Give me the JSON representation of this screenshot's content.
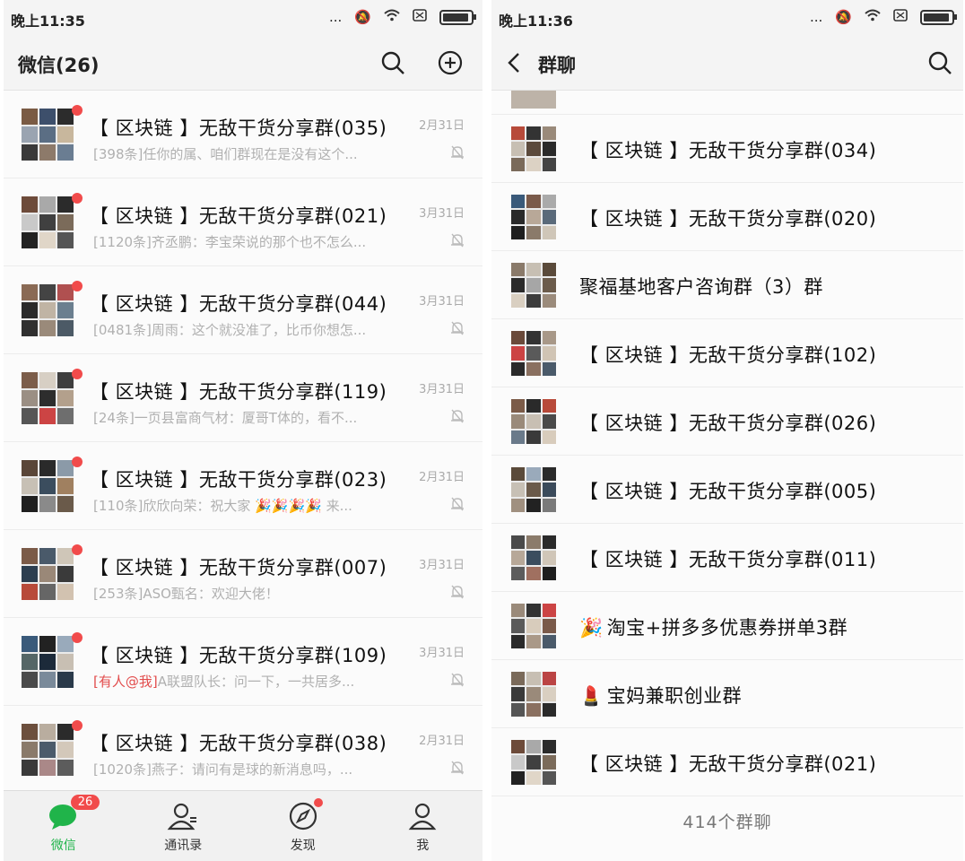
{
  "left": {
    "statusbar": {
      "time": "晚上11:35",
      "dots": "..."
    },
    "header": {
      "title": "微信(26)"
    },
    "chats": [
      {
        "name": "【 区块链 】无敌干货分享群(035)",
        "time": "2月31日",
        "preview": "[398条]任你的属、咱们群现在是没有这个...",
        "mention": "",
        "colors": [
          "#7a5b44",
          "#3d4f6b",
          "#2c2c2c",
          "#9aa4b1",
          "#5b6e84",
          "#c8b79d",
          "#3a3a3a",
          "#8d7a6a",
          "#6a7d92"
        ]
      },
      {
        "name": "【 区块链 】无敌干货分享群(021)",
        "time": "3月31日",
        "preview": "[1120条]齐丞鹏：李宝荣说的那个也不怎么...",
        "mention": "",
        "colors": [
          "#6d4b3a",
          "#a9a9a9",
          "#2b2b2b",
          "#c9c9c9",
          "#404040",
          "#7b6b5a",
          "#222",
          "#e0d6c8",
          "#555"
        ]
      },
      {
        "name": "【 区块链 】无敌干货分享群(044)",
        "time": "3月31日",
        "preview": "[0481条]周雨：这个就没准了，比币你想怎...",
        "mention": "",
        "colors": [
          "#8a6a55",
          "#444",
          "#b05050",
          "#2a2a2a",
          "#c0b4a4",
          "#6b7f8f",
          "#303030",
          "#9a8a7a",
          "#4c5a66"
        ]
      },
      {
        "name": "【 区块链 】无敌干货分享群(119)",
        "time": "3月31日",
        "preview": "[24条]一页县富商气材：厦哥T体的，看不...",
        "mention": "",
        "colors": [
          "#7c5d4a",
          "#d7cfc4",
          "#3e3e3e",
          "#9b8f84",
          "#2d2d2d",
          "#b3a08c",
          "#565656",
          "#c44",
          "#6e6e6e"
        ]
      },
      {
        "name": "【 区块链 】无敌干货分享群(023)",
        "time": "2月31日",
        "preview": "[110条]欣欣向荣：祝大家 🎉🎉🎉🎉 来...",
        "mention": "",
        "colors": [
          "#5a4638",
          "#2a2a2a",
          "#8b9aa8",
          "#c7c0b5",
          "#3b4d5e",
          "#a08060",
          "#1f1f1f",
          "#8a8a8a",
          "#6a5a4a"
        ]
      },
      {
        "name": "【 区块链 】无敌干货分享群(007)",
        "time": "3月31日",
        "preview": "[253条]ASO甄名：欢迎大佬！",
        "mention": "",
        "colors": [
          "#7b5b48",
          "#4a5a6a",
          "#cfc6b8",
          "#2c3e50",
          "#9a8878",
          "#3a3a3a",
          "#b84a3a",
          "#666",
          "#d2c2b0"
        ]
      },
      {
        "name": "【 区块链 】无敌干货分享群(109)",
        "time": "3月31日",
        "preview": "A联盟队长：问一下，一共居多...",
        "mention": "[有人@我]",
        "colors": [
          "#3a5a7a",
          "#222",
          "#9ab",
          "#566",
          "#1c2a3a",
          "#c8bfb3",
          "#4a4a4a",
          "#7a8a9a",
          "#2a3a4a"
        ]
      },
      {
        "name": "【 区块链 】无敌干货分享群(038)",
        "time": "2月31日",
        "preview": "[1020条]燕子：请问有是球的新消息吗，...",
        "mention": "",
        "colors": [
          "#6c4f3d",
          "#b9ad9f",
          "#2b2b2b",
          "#8a7a6a",
          "#4b5b6b",
          "#d3c8ba",
          "#3a3a3a",
          "#a88",
          "#5c5c5c"
        ]
      }
    ],
    "tabs": [
      {
        "label": "微信",
        "badge": "26"
      },
      {
        "label": "通讯录"
      },
      {
        "label": "发现"
      },
      {
        "label": "我"
      }
    ]
  },
  "right": {
    "statusbar": {
      "time": "晚上11:36",
      "dots": "..."
    },
    "header": {
      "title": "群聊"
    },
    "partial_top": {
      "name": "\""
    },
    "groups": [
      {
        "name": "【 区块链 】无敌干货分享群(034)",
        "emoji": "",
        "colors": [
          "#b74a3a",
          "#333",
          "#9a8a7a",
          "#c7bfb3",
          "#5b4a3c",
          "#2a2a2a",
          "#7a6a5a",
          "#dcd2c4",
          "#444"
        ]
      },
      {
        "name": "【 区块链 】无敌干货分享群(020)",
        "emoji": "",
        "colors": [
          "#3a5a7a",
          "#7a5a4a",
          "#aaa",
          "#2a2a2a",
          "#b8a898",
          "#5a6a7a",
          "#1f1f1f",
          "#8a7a6a",
          "#cfc6b8"
        ]
      },
      {
        "name": "聚福基地客户咨询群（3）群",
        "emoji": "",
        "colors": [
          "#8a7a6a",
          "#c7bfb3",
          "#5a4a3a",
          "#2b2b2b",
          "#a6a6a6",
          "#6b5b4b",
          "#d9cfc1",
          "#3c3c3c",
          "#9b8b7b"
        ]
      },
      {
        "name": "【 区块链 】无敌干货分享群(102)",
        "emoji": "",
        "colors": [
          "#6a4a3a",
          "#333",
          "#a89888",
          "#c44",
          "#5a5a5a",
          "#d0c4b4",
          "#2a2a2a",
          "#8a7060",
          "#4a5a6a"
        ]
      },
      {
        "name": "【 区块链 】无敌干货分享群(026)",
        "emoji": "",
        "colors": [
          "#7b5b48",
          "#2a2a2a",
          "#b84a3a",
          "#9a8a7a",
          "#c8bfb3",
          "#4a4a4a",
          "#6a7a8a",
          "#3a3a3a",
          "#d8ccbc"
        ]
      },
      {
        "name": "【 区块链 】无敌干货分享群(005)",
        "emoji": "",
        "colors": [
          "#5a4a3a",
          "#9aaabb",
          "#2a2a2a",
          "#c7c0b5",
          "#6a5a4a",
          "#3b4b5b",
          "#a09080",
          "#222",
          "#7a7a7a"
        ]
      },
      {
        "name": "【 区块链 】无敌干货分享群(011)",
        "emoji": "",
        "colors": [
          "#4a4a4a",
          "#8b7b6b",
          "#2a2a2a",
          "#b7a898",
          "#3b4d5e",
          "#d0c6b8",
          "#5c5c5c",
          "#a07060",
          "#1e1e1e"
        ]
      },
      {
        "name": "淘宝+拼多多优惠券拼单3群",
        "emoji": "🎉",
        "colors": [
          "#9a8a7a",
          "#333",
          "#c44",
          "#5a5a5a",
          "#d8ccbc",
          "#7a5a4a",
          "#2a2a2a",
          "#aa9988",
          "#4a5a6a"
        ]
      },
      {
        "name": "宝妈兼职创业群",
        "emoji": "💄",
        "colors": [
          "#7a6a5a",
          "#c7bfb3",
          "#b44",
          "#3a3a3a",
          "#9a8a7a",
          "#d9cfc1",
          "#555",
          "#8a7060",
          "#2a2a2a"
        ]
      },
      {
        "name": "【 区块链 】无敌干货分享群(021)",
        "emoji": "",
        "colors": [
          "#6d4b3a",
          "#a9a9a9",
          "#2b2b2b",
          "#c9c9c9",
          "#404040",
          "#7b6b5a",
          "#222",
          "#e0d6c8",
          "#555"
        ]
      }
    ],
    "footer": {
      "count": "414个群聊"
    }
  }
}
